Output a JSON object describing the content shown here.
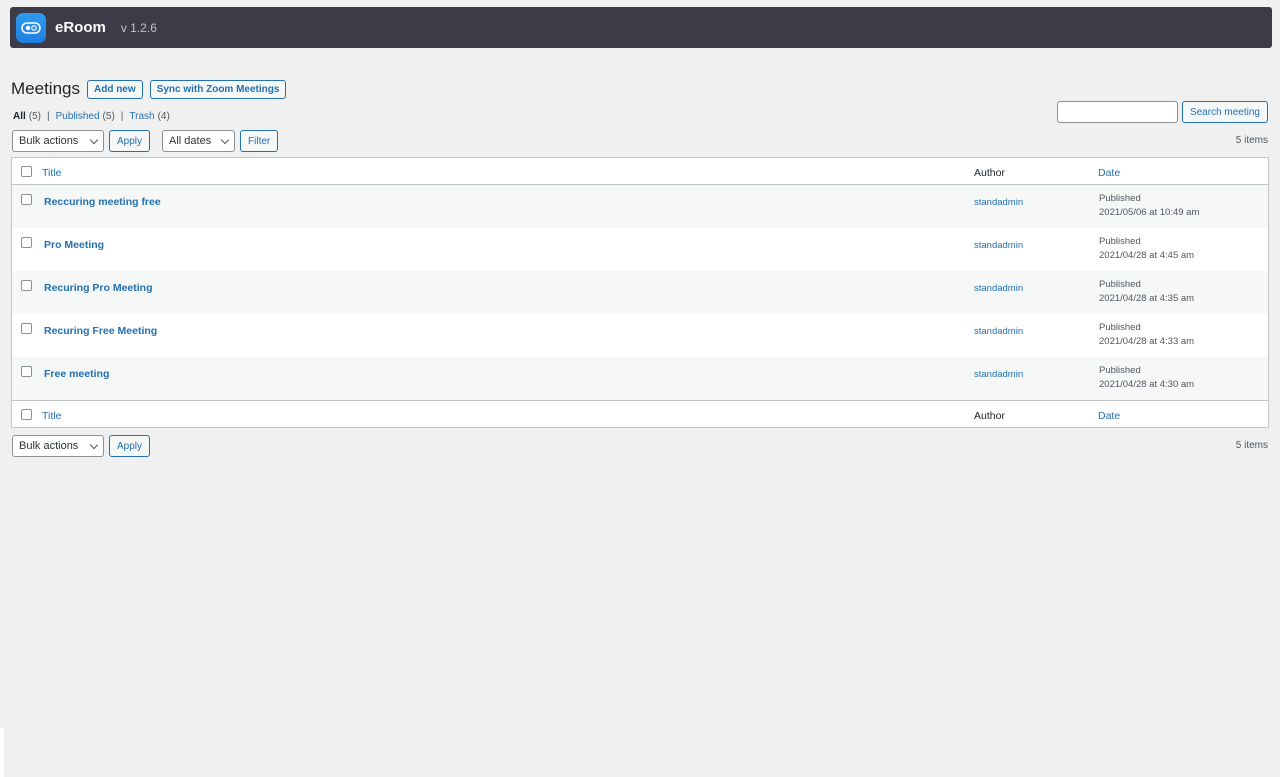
{
  "header": {
    "brand": "eRoom",
    "version": "v 1.2.6"
  },
  "page": {
    "title": "Meetings",
    "add_new_label": "Add new",
    "sync_label": "Sync with Zoom Meetings"
  },
  "views": {
    "all": {
      "label": "All",
      "count": "(5)"
    },
    "published": {
      "label": "Published",
      "count": "(5)"
    },
    "trash": {
      "label": "Trash",
      "count": "(4)"
    },
    "separator": "|"
  },
  "search": {
    "button_label": "Search meeting",
    "value": ""
  },
  "tablenav_top": {
    "bulk_label": "Bulk actions",
    "apply_label": "Apply",
    "dates_label": "All dates",
    "filter_label": "Filter",
    "items": "5 items"
  },
  "tablenav_bottom": {
    "bulk_label": "Bulk actions",
    "apply_label": "Apply",
    "items": "5 items"
  },
  "table": {
    "columns": {
      "title": "Title",
      "author": "Author",
      "date": "Date"
    },
    "rows": [
      {
        "title": "Reccuring meeting free",
        "author": "standadmin",
        "status": "Published",
        "date": "2021/05/06 at 10:49 am"
      },
      {
        "title": "Pro Meeting",
        "author": "standadmin",
        "status": "Published",
        "date": "2021/04/28 at 4:45 am"
      },
      {
        "title": "Recuring Pro Meeting",
        "author": "standadmin",
        "status": "Published",
        "date": "2021/04/28 at 4:35 am"
      },
      {
        "title": "Recuring Free Meeting",
        "author": "standadmin",
        "status": "Published",
        "date": "2021/04/28 at 4:33 am"
      },
      {
        "title": "Free meeting",
        "author": "standadmin",
        "status": "Published",
        "date": "2021/04/28 at 4:30 am"
      }
    ]
  },
  "colors": {
    "topbar": "#3c3b47",
    "link": "#2271b1",
    "background": "#f0f0f1",
    "logo": "#1f7fe0"
  }
}
